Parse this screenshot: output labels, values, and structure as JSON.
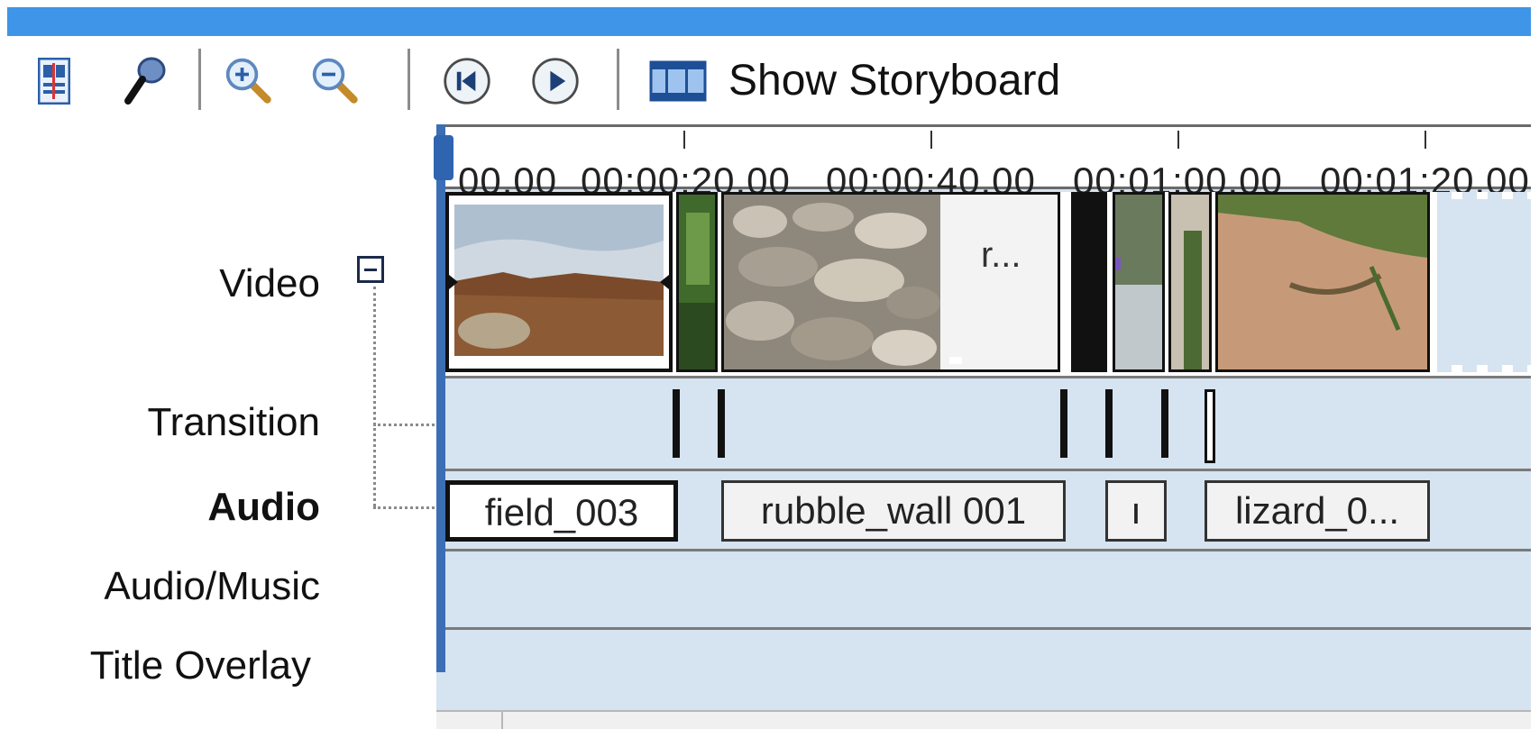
{
  "toolbar": {
    "show_storyboard_label": "Show Storyboard",
    "icons": [
      "timeline-view-icon",
      "narrate-microphone-icon",
      "zoom-in-icon",
      "zoom-out-icon",
      "rewind-icon",
      "play-icon",
      "storyboard-filmstrip-icon"
    ]
  },
  "ruler": {
    "ticks": [
      "00.00",
      "00:00:20.00",
      "00:00:40.00",
      "00:01:00.00",
      "00:01:20.00"
    ]
  },
  "tracks": {
    "video": "Video",
    "transition": "Transition",
    "audio": "Audio",
    "audio_music": "Audio/Music",
    "title_overlay": "Title Overlay"
  },
  "video_clips": {
    "rubble_caption": "r..."
  },
  "audio_clips": [
    {
      "label": "field_003"
    },
    {
      "label": "rubble_wall 001"
    },
    {
      "label": "ı"
    },
    {
      "label": "lizard_0..."
    }
  ],
  "colors": {
    "titlebar": "#3f95e8",
    "track_bg": "#d6e3f0",
    "playhead": "#3b6eb5"
  }
}
